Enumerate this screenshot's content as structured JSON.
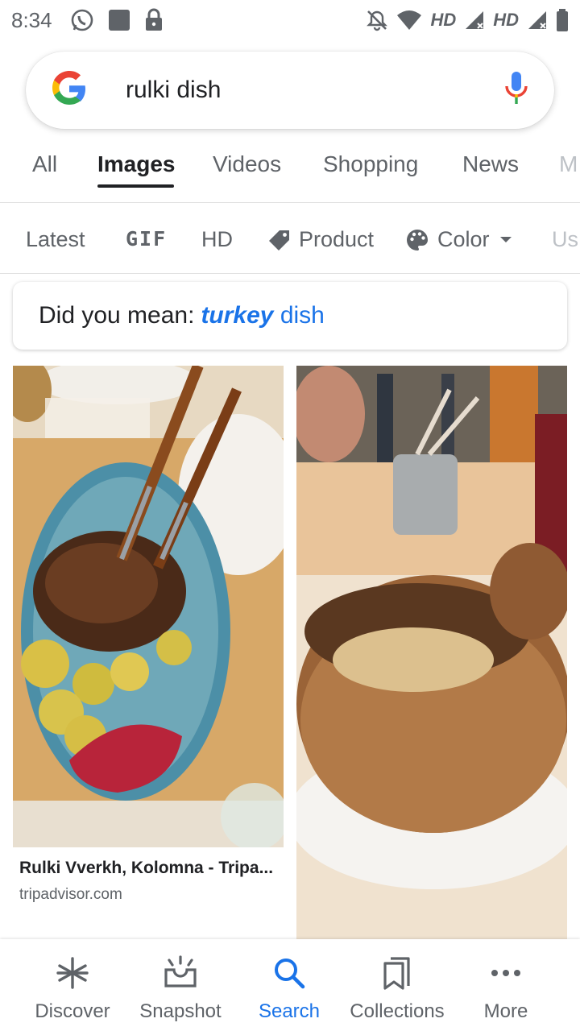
{
  "status_bar": {
    "time": "8:34",
    "hd1": "HD",
    "hd2": "HD"
  },
  "search": {
    "query": "rulki dish",
    "logo_icon": "google-g-logo",
    "mic_icon": "mic-icon"
  },
  "tabs": [
    {
      "label": "All",
      "active": false
    },
    {
      "label": "Images",
      "active": true
    },
    {
      "label": "Videos",
      "active": false
    },
    {
      "label": "Shopping",
      "active": false
    },
    {
      "label": "News",
      "active": false
    },
    {
      "label": "M",
      "active": false
    }
  ],
  "chips": {
    "latest": "Latest",
    "gif": "GIF",
    "hd": "HD",
    "product": "Product",
    "color": "Color",
    "usage": "Us"
  },
  "did_you_mean": {
    "prefix": "Did you mean:",
    "suggestion_bold": "turkey",
    "suggestion_rest": "dish"
  },
  "results": [
    {
      "title": "Rulki Vverkh, Kolomna - Tripa...",
      "source": "tripadvisor.com",
      "image": "roasted pork knuckle with potatoes and red cabbage on blue platter"
    },
    {
      "title": "",
      "source": "",
      "image": "soup served in a bread bowl"
    }
  ],
  "bottom_nav": [
    {
      "label": "Discover",
      "icon": "asterisk-icon",
      "active": false
    },
    {
      "label": "Snapshot",
      "icon": "snapshot-icon",
      "active": false
    },
    {
      "label": "Search",
      "icon": "search-icon",
      "active": true
    },
    {
      "label": "Collections",
      "icon": "bookmarks-icon",
      "active": false
    },
    {
      "label": "More",
      "icon": "more-dots-icon",
      "active": false
    }
  ],
  "colors": {
    "accent": "#1a73e8",
    "text": "#202124",
    "secondary": "#5f6368"
  }
}
